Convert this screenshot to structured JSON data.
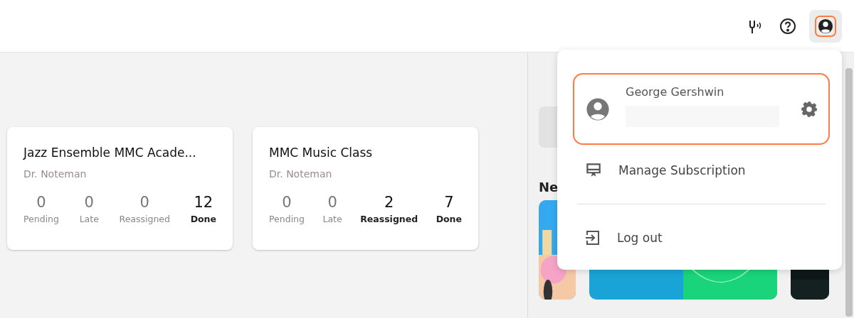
{
  "toolbar": {
    "account_button": {
      "selected": true
    }
  },
  "classes": [
    {
      "title": "Jazz Ensemble MMC Acade...",
      "teacher": "Dr. Noteman",
      "stats": [
        {
          "value": "0",
          "label": "Pending",
          "emphasized": false
        },
        {
          "value": "0",
          "label": "Late",
          "emphasized": false
        },
        {
          "value": "0",
          "label": "Reassigned",
          "emphasized": false
        },
        {
          "value": "12",
          "label": "Done",
          "emphasized": true
        }
      ]
    },
    {
      "title": "MMC Music Class",
      "teacher": "Dr. Noteman",
      "stats": [
        {
          "value": "0",
          "label": "Pending",
          "emphasized": false
        },
        {
          "value": "0",
          "label": "Late",
          "emphasized": false
        },
        {
          "value": "2",
          "label": "Reassigned",
          "emphasized": true
        },
        {
          "value": "7",
          "label": "Done",
          "emphasized": true
        }
      ]
    }
  ],
  "side_panel": {
    "heading": "Ne"
  },
  "account_menu": {
    "user_name": "George Gershwin",
    "items": [
      {
        "kind": "subscription",
        "label": "Manage Subscription"
      },
      {
        "kind": "logout",
        "label": "Log out"
      }
    ]
  }
}
